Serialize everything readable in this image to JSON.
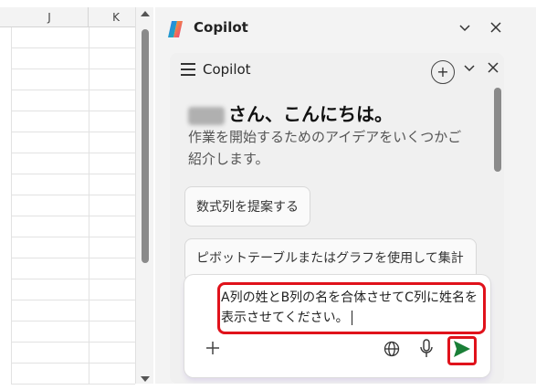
{
  "sheet": {
    "columns": [
      "J",
      "K"
    ]
  },
  "pane": {
    "title": "Copilot",
    "header_icons": [
      "chevron-down-icon",
      "close-icon"
    ]
  },
  "card": {
    "title": "Copilot",
    "greeting_suffix": "さん、こんにちは。",
    "intro": "作業を開始するためのアイデアをいくつかご紹介します。",
    "suggestions": [
      "数式列を提案する",
      "ピボットテーブルまたはグラフを使用して集計"
    ]
  },
  "input": {
    "value": "A列の姓とB列の名を合体させてC列に姓名を表示させてください。"
  },
  "colors": {
    "highlight": "#e0121b",
    "send_green": "#1a7f37"
  }
}
